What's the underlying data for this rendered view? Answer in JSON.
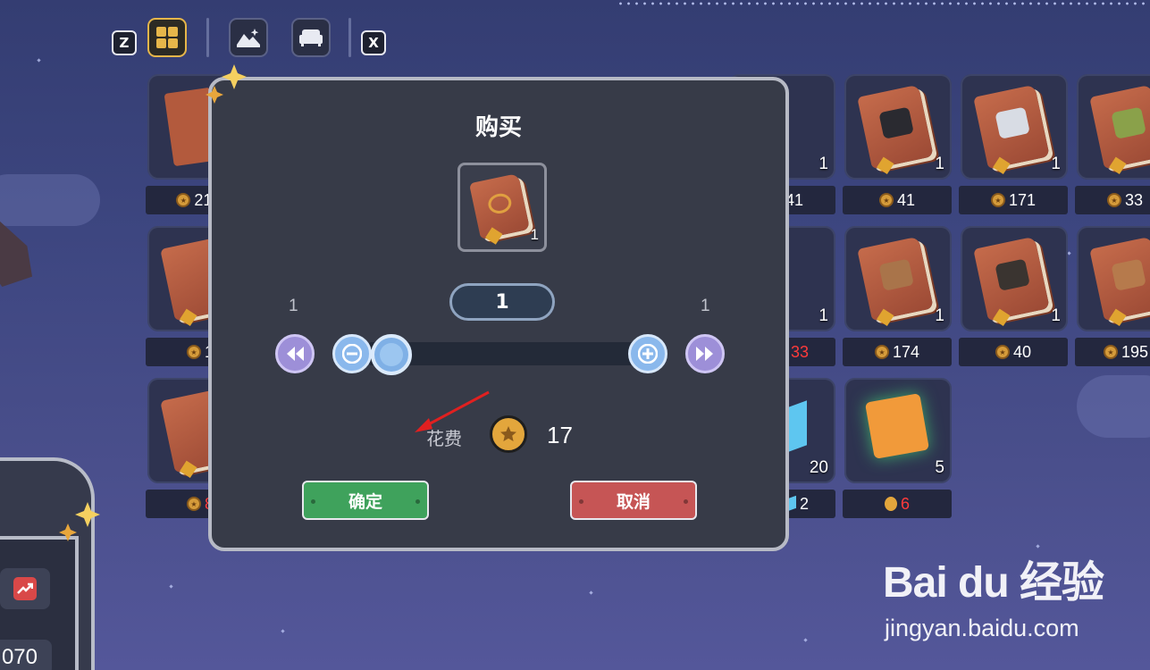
{
  "toolbar": {
    "key_left": "Z",
    "key_right": "X",
    "tools": [
      "grid-icon",
      "landscape-icon",
      "sofa-icon"
    ]
  },
  "grid": {
    "top_row": [
      {
        "count": "",
        "price": "21",
        "price_suffix": "▶"
      },
      {
        "count": "1",
        "price": "41"
      },
      {
        "count": "1",
        "price": "41"
      },
      {
        "count": "1",
        "price": "171"
      },
      {
        "count": "",
        "price": "33"
      }
    ],
    "middle_row": [
      {
        "count": "",
        "price": "1"
      },
      {
        "count": "1",
        "price": "33",
        "price_color": "red"
      },
      {
        "count": "1",
        "price": "174"
      },
      {
        "count": "1",
        "price": "40"
      },
      {
        "count": "",
        "price": "195"
      }
    ],
    "bottom_row": [
      {
        "count": "",
        "price": "8",
        "price_color": "red"
      },
      {
        "count": "20",
        "price": "2",
        "currency": "crystal"
      },
      {
        "count": "5",
        "price": "6",
        "currency": "medal",
        "price_color": "red"
      }
    ]
  },
  "left_panel": {
    "value": "070"
  },
  "dialog": {
    "title": "购买",
    "item_count": "1",
    "quantity": "1",
    "min": "1",
    "max": "1",
    "slider_fraction": 0,
    "cost_label": "花费",
    "cost_value": "17",
    "confirm": "确定",
    "cancel": "取消"
  },
  "watermark": {
    "logo": "Bai du 经验",
    "url": "jingyan.baidu.com"
  },
  "colors": {
    "background": "#3d4680",
    "dialog": "#373b48",
    "confirm": "#3fa25c",
    "cancel": "#c65555",
    "slider": "#8ab8ec",
    "skip": "#9d8fd8",
    "coin": "#e3a63c"
  }
}
